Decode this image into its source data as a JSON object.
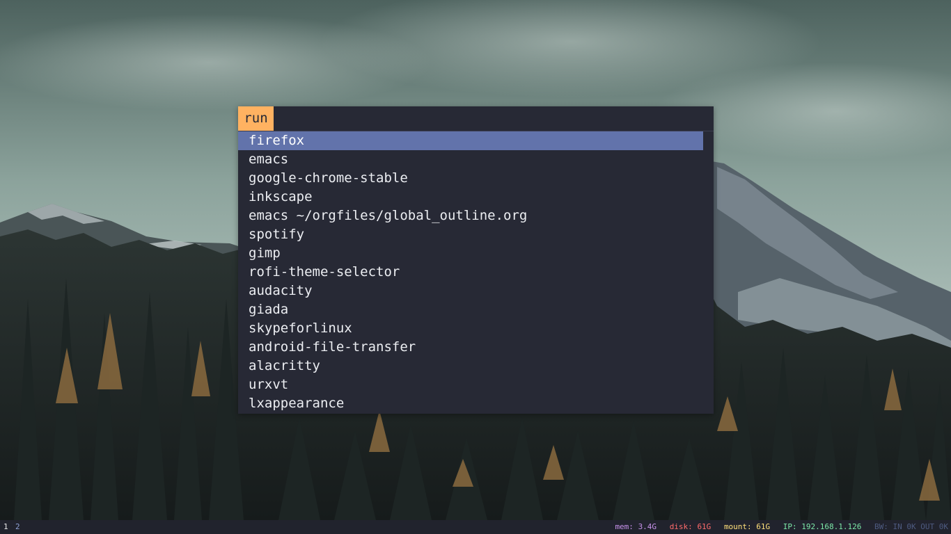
{
  "launcher": {
    "prompt": "run",
    "entry_value": "",
    "items": [
      "firefox",
      "emacs",
      "google-chrome-stable",
      "inkscape",
      "emacs ~/orgfiles/global_outline.org",
      "spotify",
      "gimp",
      "rofi-theme-selector",
      "audacity",
      "giada",
      "skypeforlinux",
      "android-file-transfer",
      "alacritty",
      "urxvt",
      "lxappearance"
    ],
    "selected_index": 0
  },
  "statusbar": {
    "workspaces": [
      "1",
      "2"
    ],
    "mem_label": "mem: ",
    "mem_value": "3.4G",
    "disk_label": "disk: ",
    "disk_value": "61G",
    "mount_label": "mount: ",
    "mount_value": "61G",
    "ip_label": "IP: ",
    "ip_value": "192.168.1.126",
    "bw_label": "BW: ",
    "bw_value": "IN 0K OUT 0K"
  },
  "colors": {
    "prompt_bg": "#ffb261",
    "selected_bg": "#6273ab",
    "launcher_bg": "#272935",
    "bar_bg": "#21232d"
  }
}
